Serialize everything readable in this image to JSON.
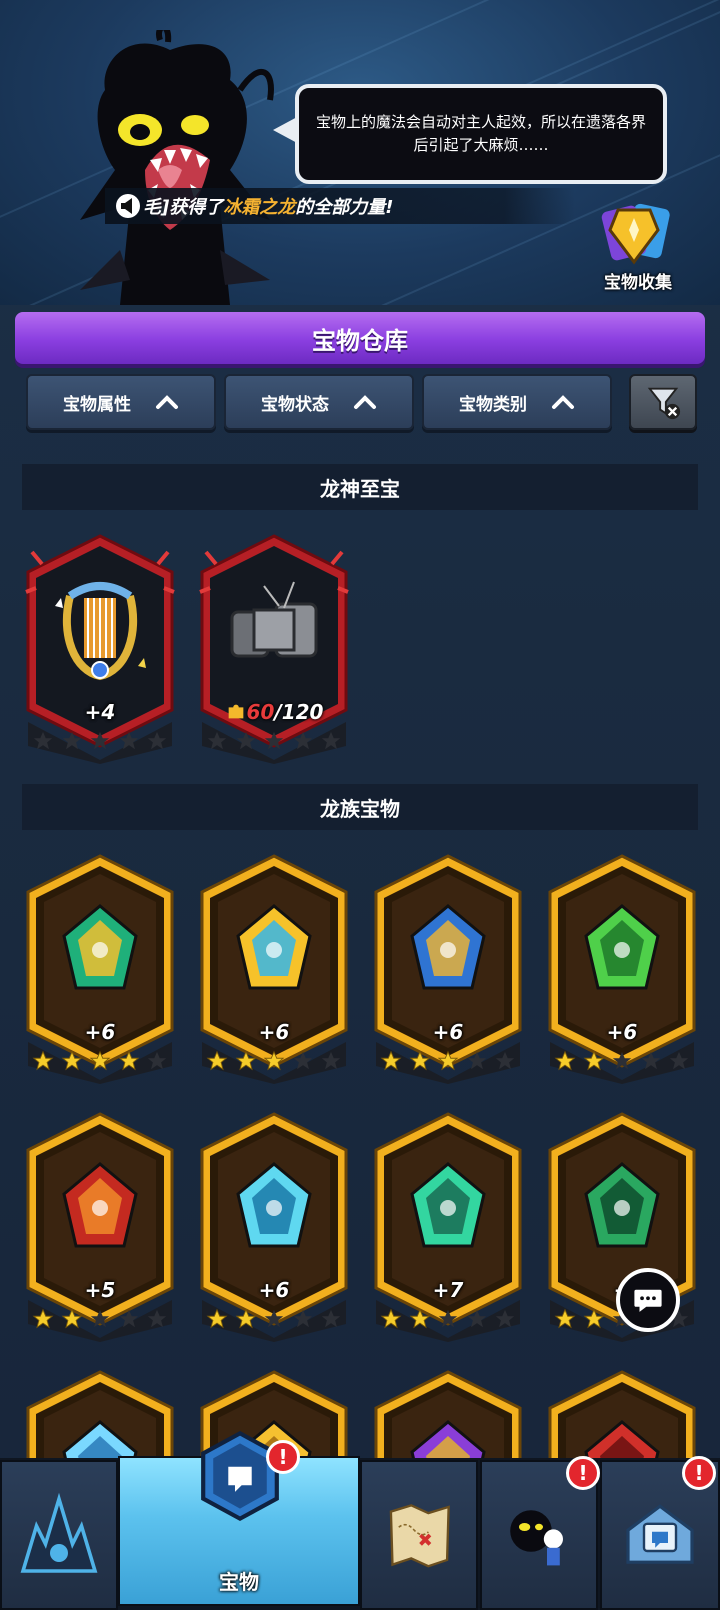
{
  "header": {
    "speech": "宝物上的魔法会自动对主人起效，所以在遗落各界后引起了大麻烦……",
    "notice_prefix": "毛]获得了",
    "notice_highlight": "冰霜之龙",
    "notice_suffix": "的全部力量!",
    "collection_label": "宝物收集"
  },
  "title": "宝物仓库",
  "filters": [
    {
      "label": "宝物属性"
    },
    {
      "label": "宝物状态"
    },
    {
      "label": "宝物类别"
    }
  ],
  "sections": {
    "divine": {
      "title": "龙神至宝",
      "items": [
        {
          "name": "harp-treasure-icon",
          "level": "+4",
          "stars": 0
        },
        {
          "name": "scroll-treasure-icon",
          "shards_current": "60",
          "shards_total": "/120",
          "stars": 0
        }
      ]
    },
    "dragon": {
      "title": "龙族宝物",
      "items": [
        {
          "name": "jade-gate-icon",
          "level": "+6",
          "stars": 4
        },
        {
          "name": "golden-spear-icon",
          "level": "+6",
          "stars": 3
        },
        {
          "name": "ice-projector-icon",
          "level": "+6",
          "stars": 3
        },
        {
          "name": "leaf-crown-icon",
          "level": "+6",
          "stars": 2
        },
        {
          "name": "fire-chest-icon",
          "level": "+5",
          "stars": 2
        },
        {
          "name": "ice-triangle-icon",
          "level": "+6",
          "stars": 2
        },
        {
          "name": "emerald-pendant-icon",
          "level": "+7",
          "stars": 2
        },
        {
          "name": "scale-shield-icon",
          "level": "+",
          "stars": 2
        },
        {
          "name": "ice-crystal-icon"
        },
        {
          "name": "thunder-crown-icon"
        },
        {
          "name": "shadow-orb-icon"
        },
        {
          "name": "rune-circle-icon"
        }
      ]
    }
  },
  "nav": {
    "active_label": "宝物",
    "badge": "!"
  },
  "colors": {
    "gold_frame": "#f2b01e",
    "red_frame": "#c9262b",
    "purple_title": "#8a3ee0",
    "highlight": "#f5b231"
  }
}
